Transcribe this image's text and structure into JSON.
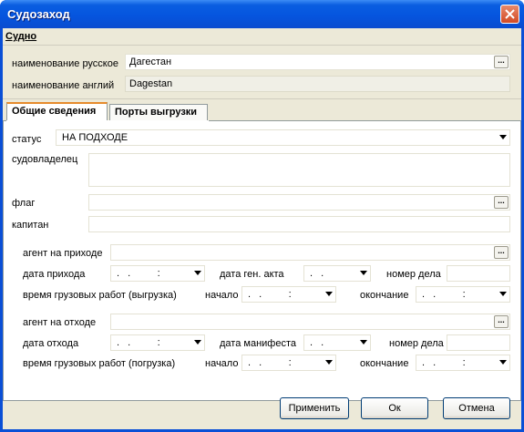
{
  "window": {
    "title": "Судозаход"
  },
  "vessel": {
    "section_label": "Судно",
    "name_ru_label": "наименование русское",
    "name_ru_value": "Дагестан",
    "name_en_label": "наименование англий",
    "name_en_value": "Dagestan"
  },
  "tabs": [
    {
      "label": "Общие сведения",
      "active": true
    },
    {
      "label": "Порты выгрузки",
      "active": false
    }
  ],
  "general": {
    "status_label": "статус",
    "status_value": "НА ПОДХОДЕ",
    "owner_label": "судовладелец",
    "owner_value": "",
    "flag_label": "флаг",
    "flag_value": "",
    "captain_label": "капитан",
    "captain_value": ""
  },
  "arrival": {
    "agent_label": "агент на приходе",
    "agent_value": "",
    "date_label": "дата прихода",
    "date_value": ".  .       :",
    "act_date_label": "дата ген. акта",
    "act_date_value": ".  .",
    "case_label": "номер дела",
    "case_value": "",
    "cargo_time_label": "время грузовых работ (выгрузка)",
    "start_label": "начало",
    "start_value": ".  .       :",
    "end_label": "окончание",
    "end_value": ".  .       :"
  },
  "departure": {
    "agent_label": "агент на отходе",
    "agent_value": "",
    "date_label": "дата отхода",
    "date_value": ".  .       :",
    "manifest_date_label": "дата манифеста",
    "manifest_date_value": ".  .",
    "case_label": "номер дела",
    "case_value": "",
    "cargo_time_label": "время грузовых работ (погрузка)",
    "start_label": "начало",
    "start_value": ".  .       :",
    "end_label": "окончание",
    "end_value": ".  .       :"
  },
  "buttons": {
    "ellipsis": "...",
    "apply": "Применить",
    "ok": "Ок",
    "cancel": "Отмена"
  },
  "icons": {
    "close": "close-icon",
    "dropdown": "chevron-down-icon"
  },
  "colors": {
    "titlebar": "#0555df",
    "window_bg": "#ece9d8",
    "active_tab_accent": "#e68b2c",
    "button_border": "#003c74"
  }
}
